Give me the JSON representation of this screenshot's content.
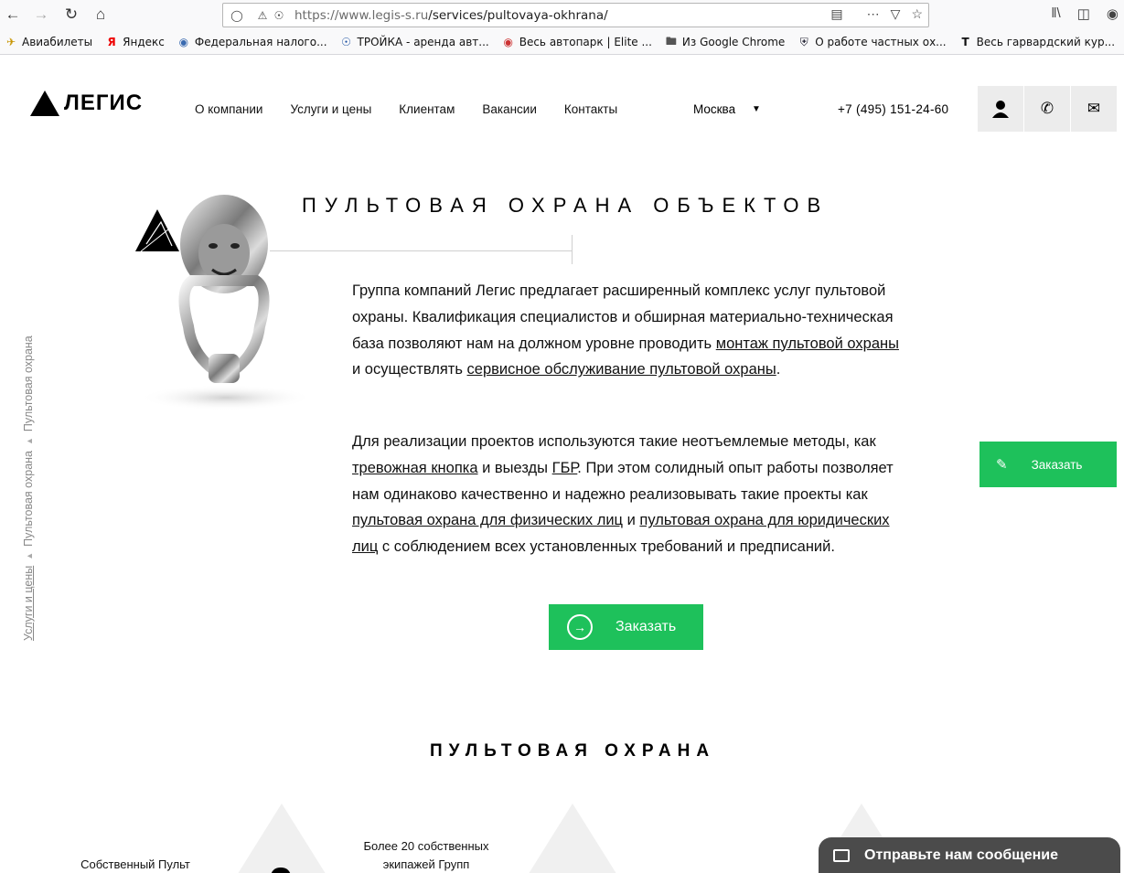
{
  "browser": {
    "url_host": "https://www.legis-s.ru",
    "url_path": "/services/pultovaya-okhrana/",
    "bookmarks": [
      {
        "label": "Авиабилеты",
        "icon": "plane-icon"
      },
      {
        "label": "Яндекс",
        "icon": "yandex-icon"
      },
      {
        "label": "Федеральная налого...",
        "icon": "tax-icon"
      },
      {
        "label": "ТРОЙКА - аренда авт...",
        "icon": "steering-wheel-icon"
      },
      {
        "label": "Весь автопарк | Elite ...",
        "icon": "car-icon"
      },
      {
        "label": "Из Google Chrome",
        "icon": "folder-icon"
      },
      {
        "label": "О работе частных ох...",
        "icon": "shield-icon"
      },
      {
        "label": "Весь гарвардский кур...",
        "icon": "t-logo-icon"
      }
    ]
  },
  "header": {
    "logo_text": "ЛЕГИС",
    "nav": [
      "О компании",
      "Услуги и цены",
      "Клиентам",
      "Вакансии",
      "Контакты"
    ],
    "city": "Москва",
    "phone": "+7 (495) 151-24-60"
  },
  "main": {
    "title": "ПУЛЬТОВАЯ ОХРАНА ОБЪЕКТОВ",
    "breadcrumb": [
      "Услуги и цены",
      "Пультовая охрана",
      "Пультовая охрана"
    ],
    "p1": {
      "a": "Группа компаний Легис предлагает расширенный комплекс услуг пультовой охраны. Квалификация специалистов и обширная материально-техническая база позволяют нам на должном уровне проводить ",
      "link1": "монтаж пультовой охраны",
      "b": " и осуществлять ",
      "link2": "сервисное обслуживание пультовой охраны",
      "c": "."
    },
    "p2": {
      "a": "Для реализации проектов используются такие неотъемлемые методы, как ",
      "link1": "тревожная кнопка",
      "b": " и выезды ",
      "link2": "ГБР",
      "c": ". При этом солидный опыт работы позволяет нам одинаково качественно и надежно реализовывать такие проекты как ",
      "link3": "пультовая охрана для физических лиц",
      "d": " и ",
      "link4": "пультовая охрана для юридических лиц",
      "e": " с соблюдением всех установленных требований и предписаний."
    },
    "order_button": "Заказать",
    "side_order_button": "Заказать",
    "section_title": "ПУЛЬТОВАЯ ОХРАНА",
    "features": [
      "Собственный Пульт",
      "Более 20 собственных экипажей Групп"
    ]
  },
  "chat": {
    "label": "Отправьте нам сообщение"
  }
}
